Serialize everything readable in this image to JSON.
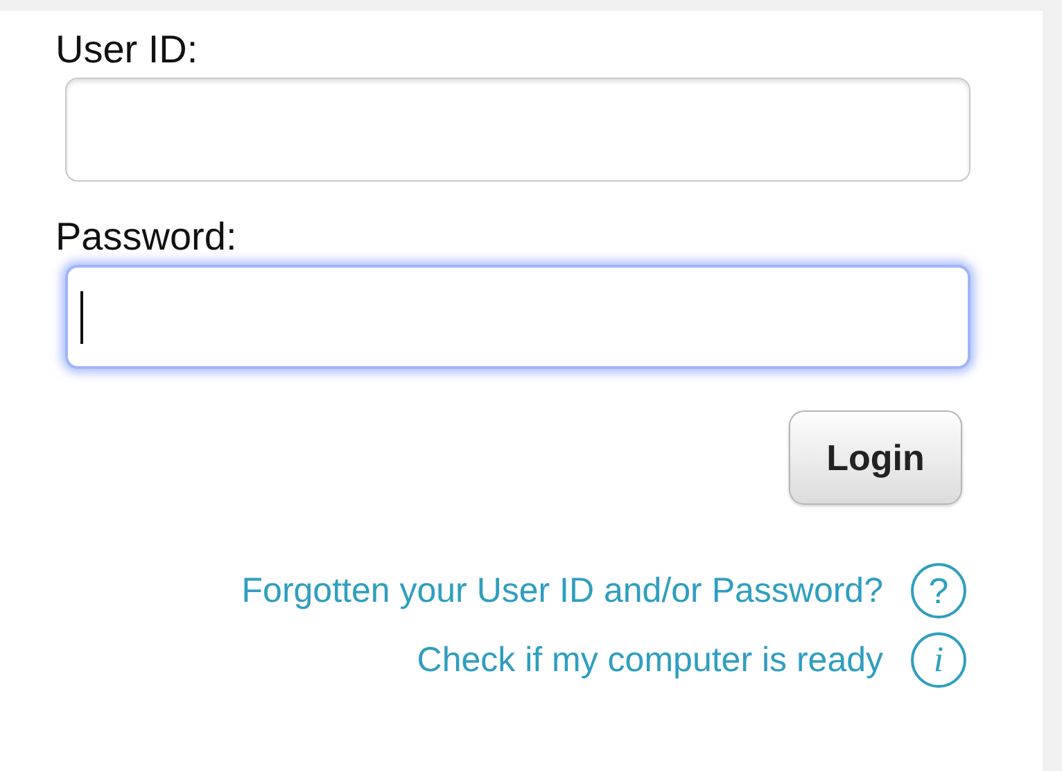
{
  "fields": [
    {
      "label": "User ID:",
      "focused": false
    },
    {
      "label": "Password:",
      "focused": true
    }
  ],
  "login_button": {
    "label": "Login"
  },
  "links": [
    {
      "text": "Forgotten your User ID and/or Password?",
      "kind": "help",
      "icon": "?"
    },
    {
      "text": "Check if my computer is ready",
      "kind": "info",
      "icon": "i"
    }
  ]
}
